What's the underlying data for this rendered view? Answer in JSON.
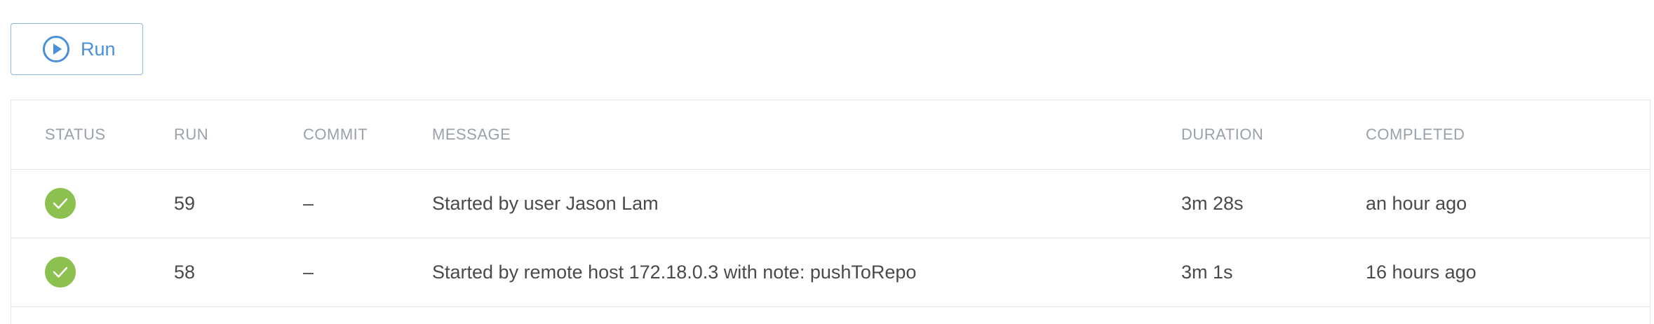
{
  "toolbar": {
    "run_label": "Run",
    "run_icon": "play-circle-icon",
    "accent_color": "#4a90d9"
  },
  "table": {
    "headers": {
      "status": "STATUS",
      "run": "RUN",
      "commit": "COMMIT",
      "message": "MESSAGE",
      "duration": "DURATION",
      "completed": "COMPLETED"
    },
    "rows": [
      {
        "status": "success",
        "status_icon": "check-circle-icon",
        "run": "59",
        "commit": "–",
        "message": "Started by user Jason Lam",
        "duration": "3m 28s",
        "completed": "an hour ago"
      },
      {
        "status": "success",
        "status_icon": "check-circle-icon",
        "run": "58",
        "commit": "–",
        "message": "Started by remote host 172.18.0.3 with note: pushToRepo",
        "duration": "3m 1s",
        "completed": "16 hours ago"
      }
    ],
    "success_color": "#8cc04f"
  }
}
